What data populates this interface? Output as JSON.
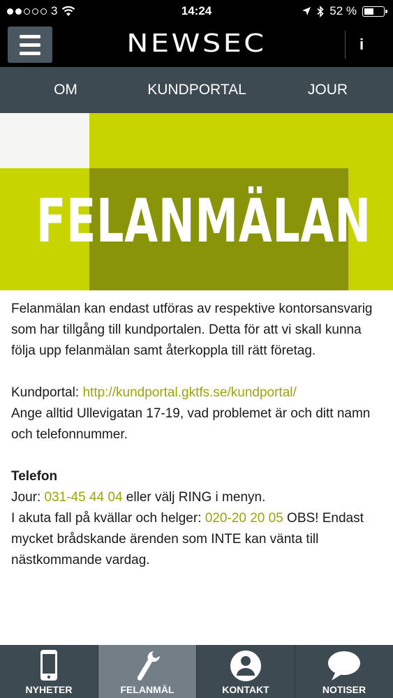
{
  "status_bar": {
    "carrier": "3",
    "time": "14:24",
    "battery": "52 %",
    "battery_level": 0.52
  },
  "header": {
    "logo": "NEWSEC",
    "info_label": "i"
  },
  "tabs": [
    {
      "label": "OM",
      "active": true
    },
    {
      "label": "KUNDPORTAL",
      "active": false
    },
    {
      "label": "JOUR",
      "active": false
    }
  ],
  "banner": {
    "title": "FELANMÄLAN"
  },
  "content": {
    "intro": "Felanmälan kan endast utföras av respektive kontorsansvarig som har tillgång till kundportalen. Detta för att vi skall kunna följa upp felanmälan samt återkoppla till rätt företag.",
    "portal_label": "Kundportal: ",
    "portal_link": "http://kundportal.gktfs.se/kundportal/",
    "portal_note": "Ange alltid Ullevigatan 17-19, vad problemet är och ditt namn och telefonnummer.",
    "phone_heading": "Telefon",
    "jour_label": "Jour: ",
    "jour_number": "031-45 44 04",
    "jour_suffix": " eller välj RING i menyn.",
    "urgent_label": "I akuta fall på kvällar och helger: ",
    "urgent_number": "020-20 20 05",
    "urgent_suffix": " OBS! Endast mycket brådskande ärenden som INTE kan vänta till nästkommande vardag."
  },
  "bottom_nav": [
    {
      "label": "NYHETER",
      "icon": "phone-icon",
      "active": false
    },
    {
      "label": "FELANMÄL",
      "icon": "wrench-icon",
      "active": true
    },
    {
      "label": "KONTAKT",
      "icon": "person-icon",
      "active": false
    },
    {
      "label": "NOTISER",
      "icon": "speech-bubble-icon",
      "active": false
    }
  ],
  "colors": {
    "accent": "#9aa50a",
    "banner_lime": "#c8d400",
    "banner_olive": "#8a9408",
    "nav_bg": "#3e4a52",
    "nav_active": "#737e86"
  }
}
